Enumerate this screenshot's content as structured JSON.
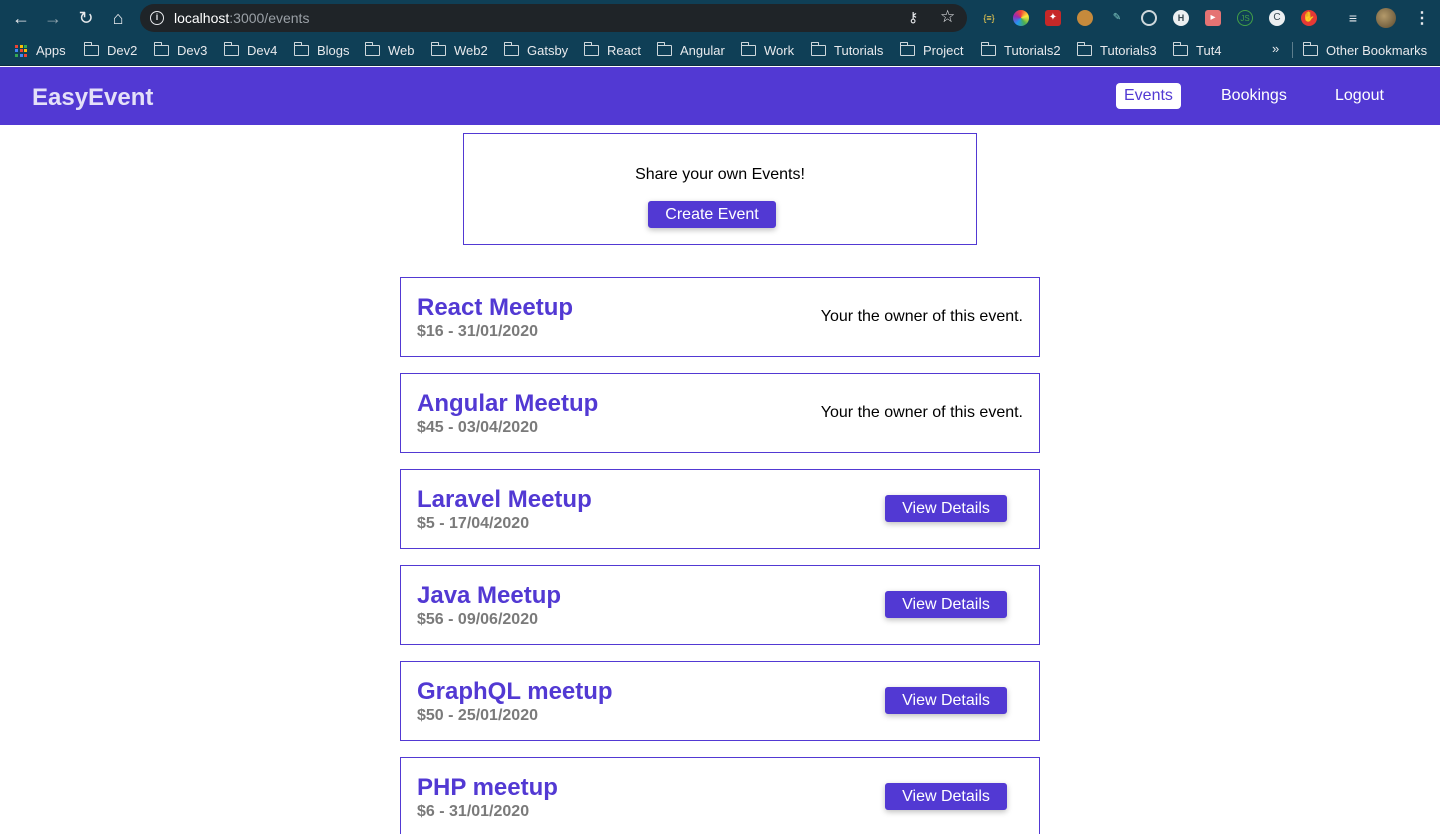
{
  "browser": {
    "url_host": "localhost",
    "url_path": ":3000/events",
    "bookmarks": [
      "Apps",
      "Dev2",
      "Dev3",
      "Dev4",
      "Blogs",
      "Web",
      "Web2",
      "Gatsby",
      "React",
      "Angular",
      "Work",
      "Tutorials",
      "Project",
      "Tutorials2",
      "Tutorials3",
      "Tut4"
    ],
    "overflow": "»",
    "other_bookmarks": "Other Bookmarks"
  },
  "header": {
    "logo": "EasyEvent",
    "nav": [
      "Events",
      "Bookings",
      "Logout"
    ],
    "active_nav": "Events"
  },
  "create": {
    "text": "Share your own Events!",
    "button": "Create Event"
  },
  "events": [
    {
      "title": "React Meetup",
      "meta": "$16 - 31/01/2020",
      "owner": true
    },
    {
      "title": "Angular Meetup",
      "meta": "$45 - 03/04/2020",
      "owner": true
    },
    {
      "title": "Laravel Meetup",
      "meta": "$5 - 17/04/2020",
      "owner": false
    },
    {
      "title": "Java Meetup",
      "meta": "$56 - 09/06/2020",
      "owner": false
    },
    {
      "title": "GraphQL meetup",
      "meta": "$50 - 25/01/2020",
      "owner": false
    },
    {
      "title": "PHP meetup",
      "meta": "$6 - 31/01/2020",
      "owner": false
    }
  ],
  "owner_text": "Your the owner of this event.",
  "details_button": "View Details",
  "colors": {
    "primary": "#5239d3",
    "chrome": "#0f3f56",
    "meta": "#7a7a7a"
  }
}
